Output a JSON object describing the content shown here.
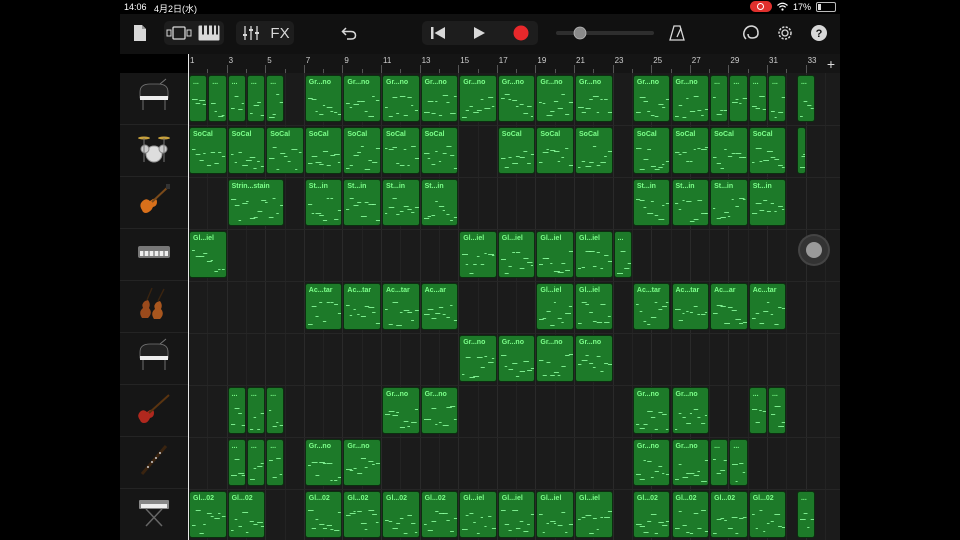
{
  "status": {
    "time": "14:06",
    "date": "4月2日(水)",
    "battery": "17%",
    "battery_level": 0.17
  },
  "toolbar": {
    "fx_label": "FX"
  },
  "ruler": {
    "bars": [
      "1",
      "3",
      "5",
      "7",
      "9",
      "11",
      "13",
      "15",
      "17",
      "19",
      "21",
      "23",
      "25",
      "27",
      "29",
      "31",
      "33"
    ],
    "add_label": "+"
  },
  "tracks": [
    {
      "name": "grand-piano",
      "regions": [
        {
          "bar": 1,
          "len": 1,
          "label": "..."
        },
        {
          "bar": 2,
          "len": 1,
          "label": "..."
        },
        {
          "bar": 3,
          "len": 1,
          "label": "..."
        },
        {
          "bar": 4,
          "len": 1,
          "label": "..."
        },
        {
          "bar": 5,
          "len": 1,
          "label": "..."
        },
        {
          "bar": 7,
          "len": 2,
          "label": "Gr...no"
        },
        {
          "bar": 9,
          "len": 2,
          "label": "Gr...no"
        },
        {
          "bar": 11,
          "len": 2,
          "label": "Gr...no"
        },
        {
          "bar": 13,
          "len": 2,
          "label": "Gr...no"
        },
        {
          "bar": 15,
          "len": 2,
          "label": "Gr...no"
        },
        {
          "bar": 17,
          "len": 2,
          "label": "Gr...no"
        },
        {
          "bar": 19,
          "len": 2,
          "label": "Gr...no"
        },
        {
          "bar": 21,
          "len": 2,
          "label": "Gr...no"
        },
        {
          "bar": 24,
          "len": 2,
          "label": "Gr...no"
        },
        {
          "bar": 26,
          "len": 2,
          "label": "Gr...no"
        },
        {
          "bar": 28,
          "len": 1,
          "label": "..."
        },
        {
          "bar": 29,
          "len": 1,
          "label": "..."
        },
        {
          "bar": 30,
          "len": 1,
          "label": "..."
        },
        {
          "bar": 31,
          "len": 1,
          "label": "..."
        },
        {
          "bar": 32.5,
          "len": 1,
          "label": "..."
        }
      ]
    },
    {
      "name": "drums",
      "regions": [
        {
          "bar": 1,
          "len": 2,
          "label": "SoCal"
        },
        {
          "bar": 3,
          "len": 2,
          "label": "SoCal"
        },
        {
          "bar": 5,
          "len": 2,
          "label": "SoCal"
        },
        {
          "bar": 7,
          "len": 2,
          "label": "SoCal"
        },
        {
          "bar": 9,
          "len": 2,
          "label": "SoCal"
        },
        {
          "bar": 11,
          "len": 2,
          "label": "SoCal"
        },
        {
          "bar": 13,
          "len": 2,
          "label": "SoCal"
        },
        {
          "bar": 17,
          "len": 2,
          "label": "SoCal"
        },
        {
          "bar": 19,
          "len": 2,
          "label": "SoCal"
        },
        {
          "bar": 21,
          "len": 2,
          "label": "SoCal"
        },
        {
          "bar": 24,
          "len": 2,
          "label": "SoCal"
        },
        {
          "bar": 26,
          "len": 2,
          "label": "SoCal"
        },
        {
          "bar": 28,
          "len": 2,
          "label": "SoCal"
        },
        {
          "bar": 30,
          "len": 2,
          "label": "SoCal"
        },
        {
          "bar": 32.5,
          "len": 0.5,
          "label": ""
        }
      ]
    },
    {
      "name": "electric-guitar",
      "regions": [
        {
          "bar": 3,
          "len": 3,
          "label": "Strin...stain"
        },
        {
          "bar": 7,
          "len": 2,
          "label": "St...in"
        },
        {
          "bar": 9,
          "len": 2,
          "label": "St...in"
        },
        {
          "bar": 11,
          "len": 2,
          "label": "St...in"
        },
        {
          "bar": 13,
          "len": 2,
          "label": "St...in"
        },
        {
          "bar": 24,
          "len": 2,
          "label": "St...in"
        },
        {
          "bar": 26,
          "len": 2,
          "label": "St...in"
        },
        {
          "bar": 28,
          "len": 2,
          "label": "St...in"
        },
        {
          "bar": 30,
          "len": 2,
          "label": "St...in"
        }
      ]
    },
    {
      "name": "keyboard",
      "regions": [
        {
          "bar": 1,
          "len": 2,
          "label": "Gl...iel"
        },
        {
          "bar": 15,
          "len": 2,
          "label": "Gl...iel"
        },
        {
          "bar": 17,
          "len": 2,
          "label": "Gl...iel"
        },
        {
          "bar": 19,
          "len": 2,
          "label": "Gl...iel"
        },
        {
          "bar": 21,
          "len": 2,
          "label": "Gl...iel"
        },
        {
          "bar": 23,
          "len": 1,
          "label": "..."
        }
      ]
    },
    {
      "name": "strings",
      "regions": [
        {
          "bar": 7,
          "len": 2,
          "label": "Ac...tar"
        },
        {
          "bar": 9,
          "len": 2,
          "label": "Ac...tar"
        },
        {
          "bar": 11,
          "len": 2,
          "label": "Ac...tar"
        },
        {
          "bar": 13,
          "len": 2,
          "label": "Ac...ar"
        },
        {
          "bar": 19,
          "len": 2,
          "label": "Gl...iel"
        },
        {
          "bar": 21,
          "len": 2,
          "label": "Gl...iel"
        },
        {
          "bar": 24,
          "len": 2,
          "label": "Ac...tar"
        },
        {
          "bar": 26,
          "len": 2,
          "label": "Ac...tar"
        },
        {
          "bar": 28,
          "len": 2,
          "label": "Ac...ar"
        },
        {
          "bar": 30,
          "len": 2,
          "label": "Ac...tar"
        }
      ]
    },
    {
      "name": "grand-piano-2",
      "regions": [
        {
          "bar": 15,
          "len": 2,
          "label": "Gr...no"
        },
        {
          "bar": 17,
          "len": 2,
          "label": "Gr...no"
        },
        {
          "bar": 19,
          "len": 2,
          "label": "Gr...no"
        },
        {
          "bar": 21,
          "len": 2,
          "label": "Gr...no"
        }
      ]
    },
    {
      "name": "bass-guitar",
      "regions": [
        {
          "bar": 3,
          "len": 1,
          "label": "..."
        },
        {
          "bar": 4,
          "len": 1,
          "label": "..."
        },
        {
          "bar": 5,
          "len": 1,
          "label": "..."
        },
        {
          "bar": 11,
          "len": 2,
          "label": "Gr...no"
        },
        {
          "bar": 13,
          "len": 2,
          "label": "Gr...no"
        },
        {
          "bar": 24,
          "len": 2,
          "label": "Gr...no"
        },
        {
          "bar": 26,
          "len": 2,
          "label": "Gr...no"
        },
        {
          "bar": 30,
          "len": 1,
          "label": "..."
        },
        {
          "bar": 31,
          "len": 1,
          "label": "..."
        }
      ]
    },
    {
      "name": "woodwind",
      "regions": [
        {
          "bar": 3,
          "len": 1,
          "label": "..."
        },
        {
          "bar": 4,
          "len": 1,
          "label": "..."
        },
        {
          "bar": 5,
          "len": 1,
          "label": "..."
        },
        {
          "bar": 7,
          "len": 2,
          "label": "Gr...no"
        },
        {
          "bar": 9,
          "len": 2,
          "label": "Gr...no"
        },
        {
          "bar": 24,
          "len": 2,
          "label": "Gr...no"
        },
        {
          "bar": 26,
          "len": 2,
          "label": "Gr...no"
        },
        {
          "bar": 28,
          "len": 1,
          "label": "..."
        },
        {
          "bar": 29,
          "len": 1,
          "label": "..."
        }
      ]
    },
    {
      "name": "synth-keyboard",
      "regions": [
        {
          "bar": 1,
          "len": 2,
          "label": "Gl...02"
        },
        {
          "bar": 3,
          "len": 2,
          "label": "Gl...02"
        },
        {
          "bar": 7,
          "len": 2,
          "label": "Gl...02"
        },
        {
          "bar": 9,
          "len": 2,
          "label": "Gl...02"
        },
        {
          "bar": 11,
          "len": 2,
          "label": "Gl...02"
        },
        {
          "bar": 13,
          "len": 2,
          "label": "Gl...02"
        },
        {
          "bar": 15,
          "len": 2,
          "label": "Gl...iel"
        },
        {
          "bar": 17,
          "len": 2,
          "label": "Gl...iel"
        },
        {
          "bar": 19,
          "len": 2,
          "label": "Gl...iel"
        },
        {
          "bar": 21,
          "len": 2,
          "label": "Gl...iel"
        },
        {
          "bar": 24,
          "len": 2,
          "label": "Gl...02"
        },
        {
          "bar": 26,
          "len": 2,
          "label": "Gl...02"
        },
        {
          "bar": 28,
          "len": 2,
          "label": "Gl...02"
        },
        {
          "bar": 30,
          "len": 2,
          "label": "Gl...02"
        },
        {
          "bar": 32.5,
          "len": 1,
          "label": "..."
        }
      ]
    }
  ],
  "colors": {
    "region": "#1d7a29",
    "region_label": "#7cff8a",
    "record": "#e8282b"
  }
}
